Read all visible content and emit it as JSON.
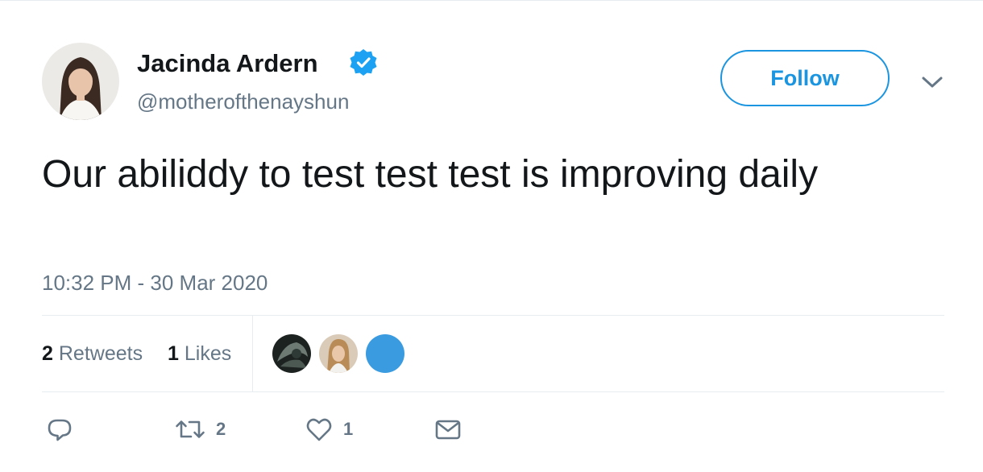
{
  "author": {
    "name": "Jacinda Ardern",
    "handle": "@motherofthenayshun",
    "verified": true,
    "avatar": "profile-photo"
  },
  "follow_label": "Follow",
  "tweet": {
    "text": "Our abiliddy to test test test is improving daily",
    "timestamp": "10:32 PM - 30 Mar 2020"
  },
  "stats": {
    "retweets_count": "2",
    "retweets_label": "Retweets",
    "likes_count": "1",
    "likes_label": "Likes"
  },
  "actions": {
    "reply": {
      "icon": "reply-icon"
    },
    "retweet": {
      "icon": "retweet-icon",
      "count": "2"
    },
    "like": {
      "icon": "heart-icon",
      "count": "1"
    },
    "dm": {
      "icon": "envelope-icon"
    }
  },
  "colors": {
    "accent": "#1b95e0",
    "secondary_text": "#657786",
    "primary_text": "#14171a",
    "border": "#e6ecf0"
  }
}
